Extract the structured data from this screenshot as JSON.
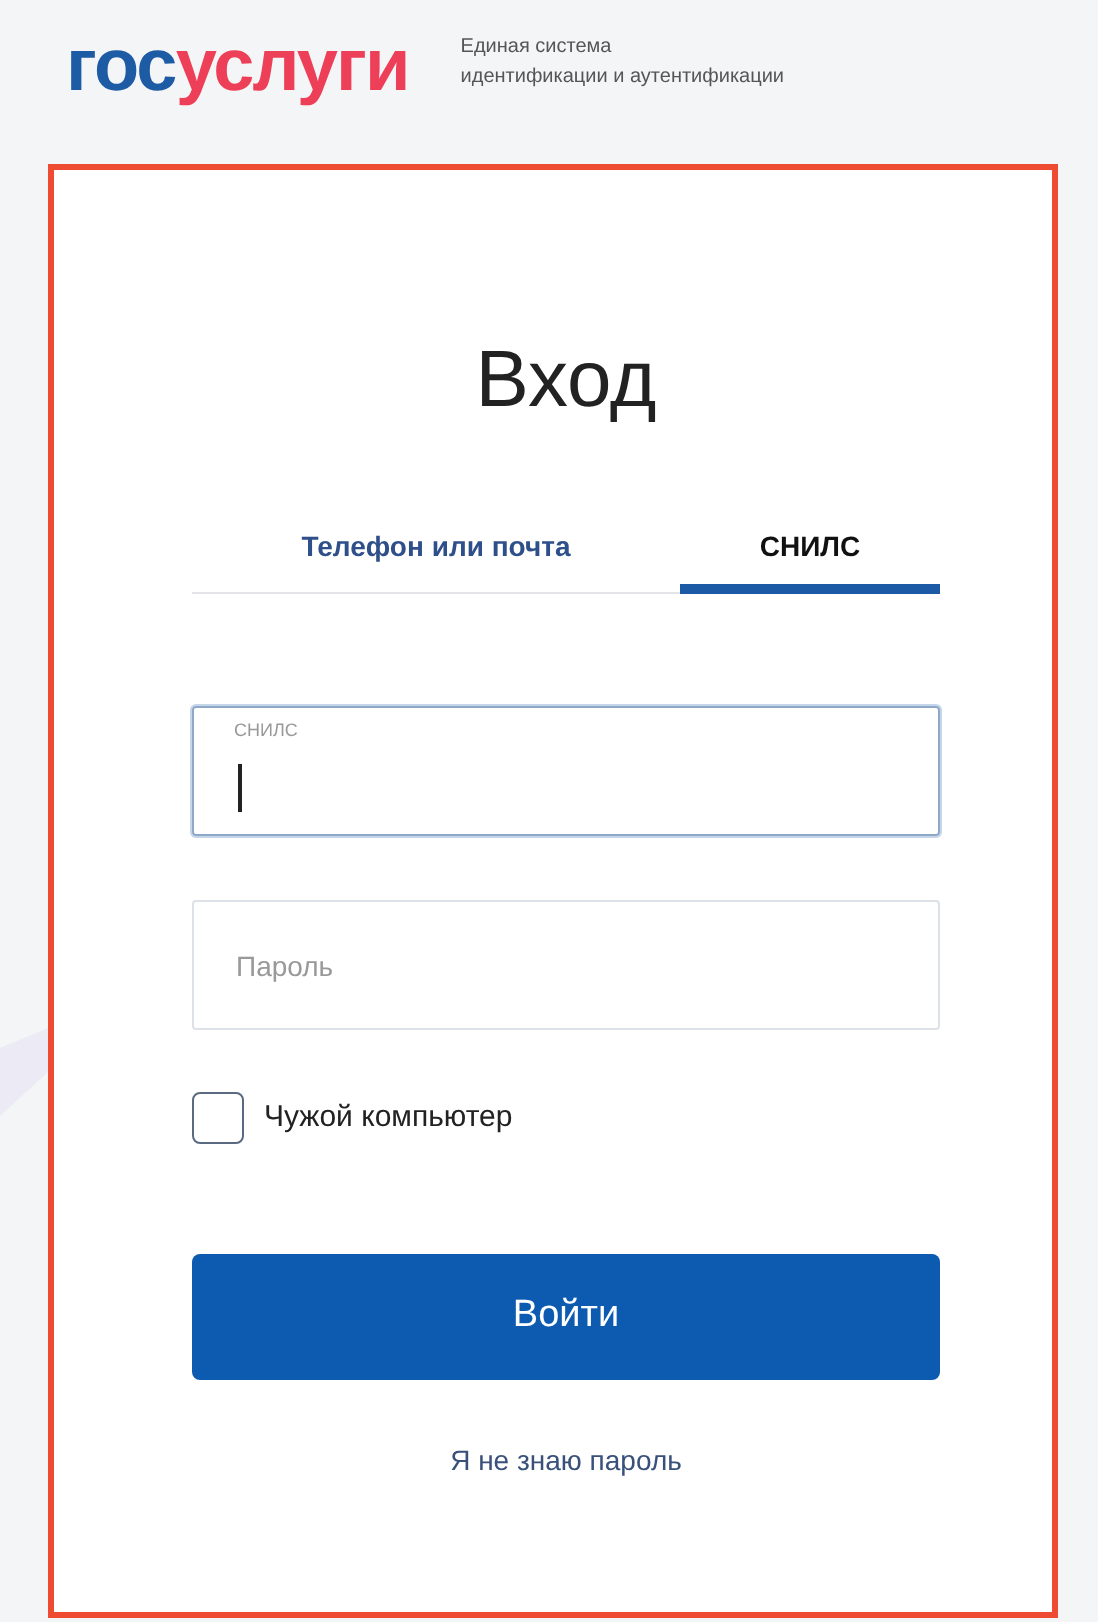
{
  "header": {
    "logo": {
      "prefix": "гос",
      "suffix": "услуги"
    },
    "tagline": [
      "Единая система",
      "идентификации и аутентификации"
    ]
  },
  "login": {
    "title": "Вход",
    "tabs": [
      {
        "label": "Телефон или почта",
        "selected": false
      },
      {
        "label": "СНИЛС",
        "selected": true
      }
    ],
    "fields": [
      {
        "label": "СНИЛС",
        "focused": true
      },
      {
        "placeholder": "Пароль",
        "focused": false
      }
    ],
    "checkbox": {
      "label": "Чужой компьютер",
      "checked": false
    },
    "submit": "Войти",
    "forgot_link": "Я не знаю пароль"
  }
}
